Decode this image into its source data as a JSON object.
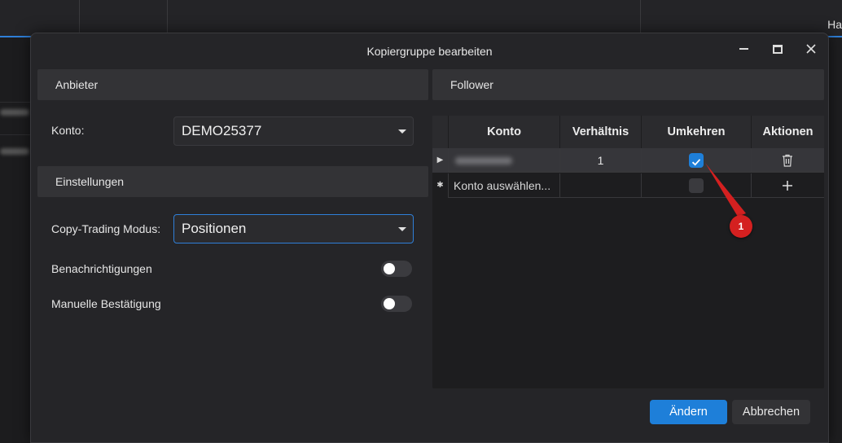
{
  "background": {
    "corner_text": "Ha"
  },
  "dialog": {
    "title": "Kopiergruppe bearbeiten",
    "provider": {
      "header": "Anbieter",
      "account_label": "Konto:",
      "account_value": "DEMO25377"
    },
    "settings": {
      "header": "Einstellungen",
      "mode_label": "Copy-Trading Modus:",
      "mode_value": "Positionen",
      "notifications_label": "Benachrichtigungen",
      "notifications_on": false,
      "manual_confirm_label": "Manuelle Bestätigung",
      "manual_confirm_on": false
    },
    "follower": {
      "header": "Follower",
      "columns": [
        "Konto",
        "Verhältnis",
        "Umkehren",
        "Aktionen"
      ],
      "rows": [
        {
          "marker": "▶",
          "account": "",
          "ratio": "1",
          "invert": true,
          "action": "delete"
        },
        {
          "marker": "✱",
          "account": "Konto auswählen...",
          "ratio": "",
          "invert": false,
          "action": "add"
        }
      ]
    },
    "buttons": {
      "apply": "Ändern",
      "cancel": "Abbrechen"
    }
  },
  "annotation": {
    "label": "1"
  },
  "colors": {
    "accent": "#1e7fd9",
    "annotation": "#d42020"
  }
}
